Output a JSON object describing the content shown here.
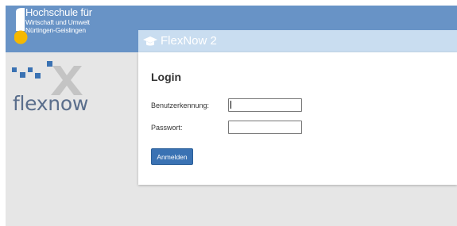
{
  "brand": {
    "university_line1": "Hochschule für",
    "university_line2": "Wirtschaft und Umwelt",
    "university_line3": "Nürtingen-Geislingen",
    "product_name": "flexnow",
    "colors": {
      "topbar": "#6893c6",
      "logo_yellow": "#f5b800",
      "logo_blue": "#3a72b3",
      "logo_gray": "#c4c4c4"
    }
  },
  "panel": {
    "header_icon": "graduation-cap-icon",
    "header_title": "FlexNow 2",
    "title": "Login",
    "username_label": "Benutzerkennung:",
    "username_value": "",
    "password_label": "Passwort:",
    "password_value": "",
    "submit_label": "Anmelden",
    "accent_color": "#3a72b3"
  }
}
